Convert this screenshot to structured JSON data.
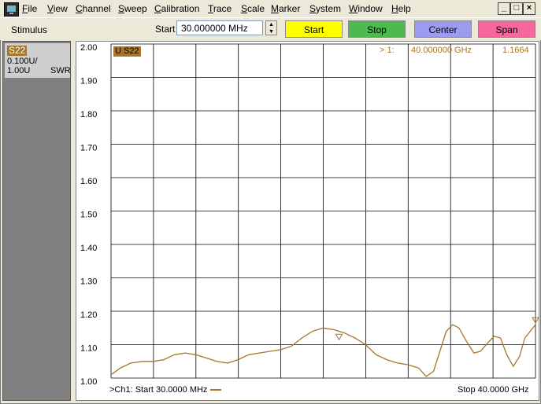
{
  "menu": {
    "items": [
      {
        "label": "File",
        "u": "F",
        "rest": "ile",
        "x": 28
      },
      {
        "label": "View",
        "u": "V",
        "rest": "iew",
        "x": 60
      },
      {
        "label": "Channel",
        "u": "C",
        "rest": "hannel",
        "x": 96
      },
      {
        "label": "Sweep",
        "u": "S",
        "rest": "weep",
        "x": 150
      },
      {
        "label": "Calibration",
        "u": "C",
        "rest": "alibration",
        "x": 196
      },
      {
        "label": "Trace",
        "u": "T",
        "rest": "race",
        "x": 264
      },
      {
        "label": "Scale",
        "u": "S",
        "rest": "cale",
        "x": 306
      },
      {
        "label": "Marker",
        "u": "M",
        "rest": "arker",
        "x": 344
      },
      {
        "label": "System",
        "u": "S",
        "rest": "ystem",
        "x": 393
      },
      {
        "label": "Window",
        "u": "W",
        "rest": "indow",
        "x": 443
      },
      {
        "label": "Help",
        "u": "H",
        "rest": "elp",
        "x": 497
      }
    ],
    "window_buttons": [
      "_",
      "□",
      "×"
    ]
  },
  "toolbar": {
    "stimulus_label": "Stimulus",
    "start_label": "Start",
    "start_value": "30.000000 MHz",
    "buttons": [
      {
        "label": "Start",
        "color": "#ffff00",
        "x": 362
      },
      {
        "label": "Stop",
        "color": "#4cba50",
        "x": 442
      },
      {
        "label": "Center",
        "color": "#9b9bf0",
        "x": 526
      },
      {
        "label": "Span",
        "color": "#f6679b",
        "x": 607
      }
    ]
  },
  "trace_panel": {
    "name": "S22",
    "scale": "0.100U/",
    "ref": "1.00U",
    "format": "SWR"
  },
  "chart": {
    "trace_tag": "U S22",
    "marker": {
      "label": "> 1:",
      "freq": "40.000000 GHz",
      "value": "1.1664"
    },
    "footer_left": ">Ch1: Start  30.0000 MHz",
    "footer_right": "Stop  40.0000 GHz",
    "trace_color": "#a7752a"
  },
  "chart_data": {
    "type": "line",
    "ylim": [
      1.0,
      2.0
    ],
    "yticks": [
      "2.00",
      "1.90",
      "1.80",
      "1.70",
      "1.60",
      "1.50",
      "1.40",
      "1.30",
      "1.20",
      "1.10",
      "1.00"
    ],
    "xlim_mhz": [
      30,
      40000
    ],
    "series": [
      {
        "values": [
          [
            30,
            1.01
          ],
          [
            900,
            1.03
          ],
          [
            1900,
            1.045
          ],
          [
            3000,
            1.05
          ],
          [
            4000,
            1.05
          ],
          [
            5000,
            1.055
          ],
          [
            6000,
            1.07
          ],
          [
            7000,
            1.075
          ],
          [
            8000,
            1.07
          ],
          [
            9000,
            1.06
          ],
          [
            10000,
            1.05
          ],
          [
            11000,
            1.045
          ],
          [
            12000,
            1.055
          ],
          [
            13000,
            1.07
          ],
          [
            14000,
            1.075
          ],
          [
            15000,
            1.08
          ],
          [
            16000,
            1.085
          ],
          [
            17000,
            1.095
          ],
          [
            18000,
            1.12
          ],
          [
            19000,
            1.14
          ],
          [
            20000,
            1.15
          ],
          [
            21000,
            1.145
          ],
          [
            22000,
            1.135
          ],
          [
            23000,
            1.12
          ],
          [
            24000,
            1.1
          ],
          [
            25000,
            1.07
          ],
          [
            26000,
            1.055
          ],
          [
            27000,
            1.045
          ],
          [
            28000,
            1.04
          ],
          [
            29000,
            1.03
          ],
          [
            29700,
            1.005
          ],
          [
            30400,
            1.02
          ],
          [
            31000,
            1.08
          ],
          [
            31600,
            1.14
          ],
          [
            32200,
            1.16
          ],
          [
            32800,
            1.15
          ],
          [
            33500,
            1.11
          ],
          [
            34200,
            1.075
          ],
          [
            34800,
            1.08
          ],
          [
            35500,
            1.105
          ],
          [
            36100,
            1.125
          ],
          [
            36700,
            1.12
          ],
          [
            37300,
            1.07
          ],
          [
            37900,
            1.035
          ],
          [
            38500,
            1.065
          ],
          [
            39000,
            1.12
          ],
          [
            39500,
            1.14
          ],
          [
            40000,
            1.16
          ]
        ]
      }
    ],
    "marker_points": [
      [
        21500,
        1.11
      ],
      [
        40000,
        1.16
      ]
    ],
    "grid": true
  }
}
